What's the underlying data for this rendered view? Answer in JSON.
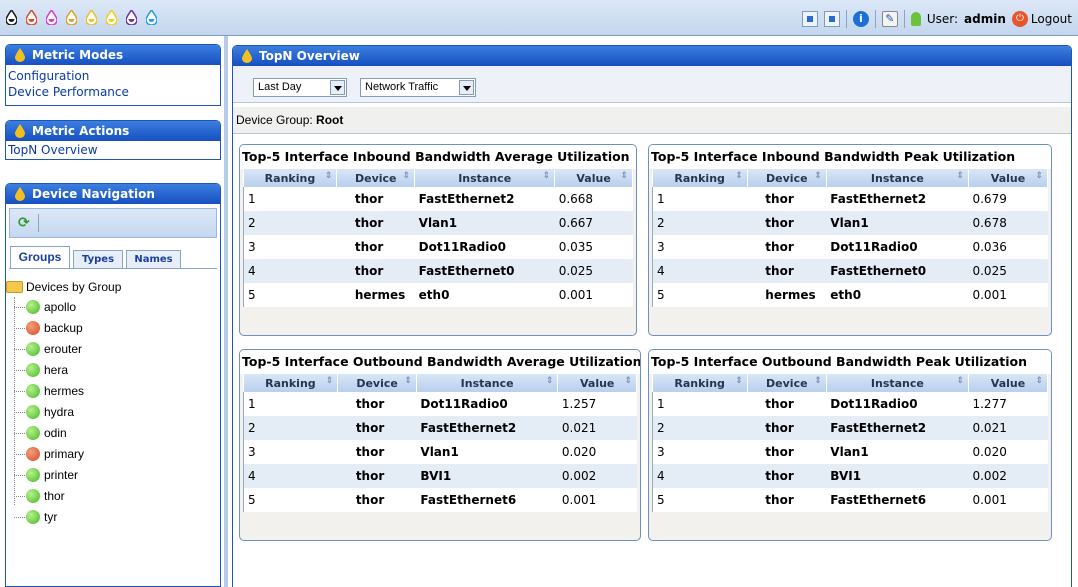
{
  "topbar": {
    "user_label": "User:",
    "user_name": "admin",
    "logout": "Logout",
    "drops": [
      "#1a1a1a",
      "#e04a2a",
      "#d83bd8",
      "#e0a020",
      "#f0c020",
      "#f0d010",
      "#7030a0",
      "#20a0e0"
    ]
  },
  "sidebar": {
    "metric_modes": {
      "title": "Metric Modes",
      "items": [
        "Configuration",
        "Device Performance"
      ]
    },
    "metric_actions": {
      "title": "Metric Actions",
      "items": [
        "TopN Overview"
      ]
    },
    "device_nav": {
      "title": "Device Navigation",
      "tabs": [
        "Groups",
        "Types",
        "Names"
      ],
      "root": "Devices by Group",
      "devices": [
        {
          "name": "apollo",
          "status": "green"
        },
        {
          "name": "backup",
          "status": "red"
        },
        {
          "name": "erouter",
          "status": "green"
        },
        {
          "name": "hera",
          "status": "green"
        },
        {
          "name": "hermes",
          "status": "green"
        },
        {
          "name": "hydra",
          "status": "green"
        },
        {
          "name": "odin",
          "status": "green"
        },
        {
          "name": "primary",
          "status": "red"
        },
        {
          "name": "printer",
          "status": "green"
        },
        {
          "name": "thor",
          "status": "green"
        },
        {
          "name": "tyr",
          "status": "green"
        }
      ]
    }
  },
  "main": {
    "title": "TopN Overview",
    "period": "Last Day",
    "metric": "Network Traffic",
    "device_group_label": "Device Group:",
    "device_group": "Root",
    "columns": [
      "Ranking",
      "Device",
      "Instance",
      "Value"
    ],
    "tables": [
      {
        "title": "Top-5 Interface Inbound Bandwidth Average Utilization",
        "rows": [
          [
            "1",
            "thor",
            "FastEthernet2",
            "0.668"
          ],
          [
            "2",
            "thor",
            "Vlan1",
            "0.667"
          ],
          [
            "3",
            "thor",
            "Dot11Radio0",
            "0.035"
          ],
          [
            "4",
            "thor",
            "FastEthernet0",
            "0.025"
          ],
          [
            "5",
            "hermes",
            "eth0",
            "0.001"
          ]
        ]
      },
      {
        "title": "Top-5 Interface Inbound Bandwidth Peak Utilization",
        "rows": [
          [
            "1",
            "thor",
            "FastEthernet2",
            "0.679"
          ],
          [
            "2",
            "thor",
            "Vlan1",
            "0.678"
          ],
          [
            "3",
            "thor",
            "Dot11Radio0",
            "0.036"
          ],
          [
            "4",
            "thor",
            "FastEthernet0",
            "0.025"
          ],
          [
            "5",
            "hermes",
            "eth0",
            "0.001"
          ]
        ]
      },
      {
        "title": "Top-5 Interface Outbound Bandwidth Average Utilization",
        "rows": [
          [
            "1",
            "thor",
            "Dot11Radio0",
            "1.257"
          ],
          [
            "2",
            "thor",
            "FastEthernet2",
            "0.021"
          ],
          [
            "3",
            "thor",
            "Vlan1",
            "0.020"
          ],
          [
            "4",
            "thor",
            "BVI1",
            "0.002"
          ],
          [
            "5",
            "thor",
            "FastEthernet6",
            "0.001"
          ]
        ]
      },
      {
        "title": "Top-5 Interface Outbound Bandwidth Peak Utilization",
        "rows": [
          [
            "1",
            "thor",
            "Dot11Radio0",
            "1.277"
          ],
          [
            "2",
            "thor",
            "FastEthernet2",
            "0.021"
          ],
          [
            "3",
            "thor",
            "Vlan1",
            "0.020"
          ],
          [
            "4",
            "thor",
            "BVI1",
            "0.002"
          ],
          [
            "5",
            "thor",
            "FastEthernet6",
            "0.001"
          ]
        ]
      }
    ]
  }
}
